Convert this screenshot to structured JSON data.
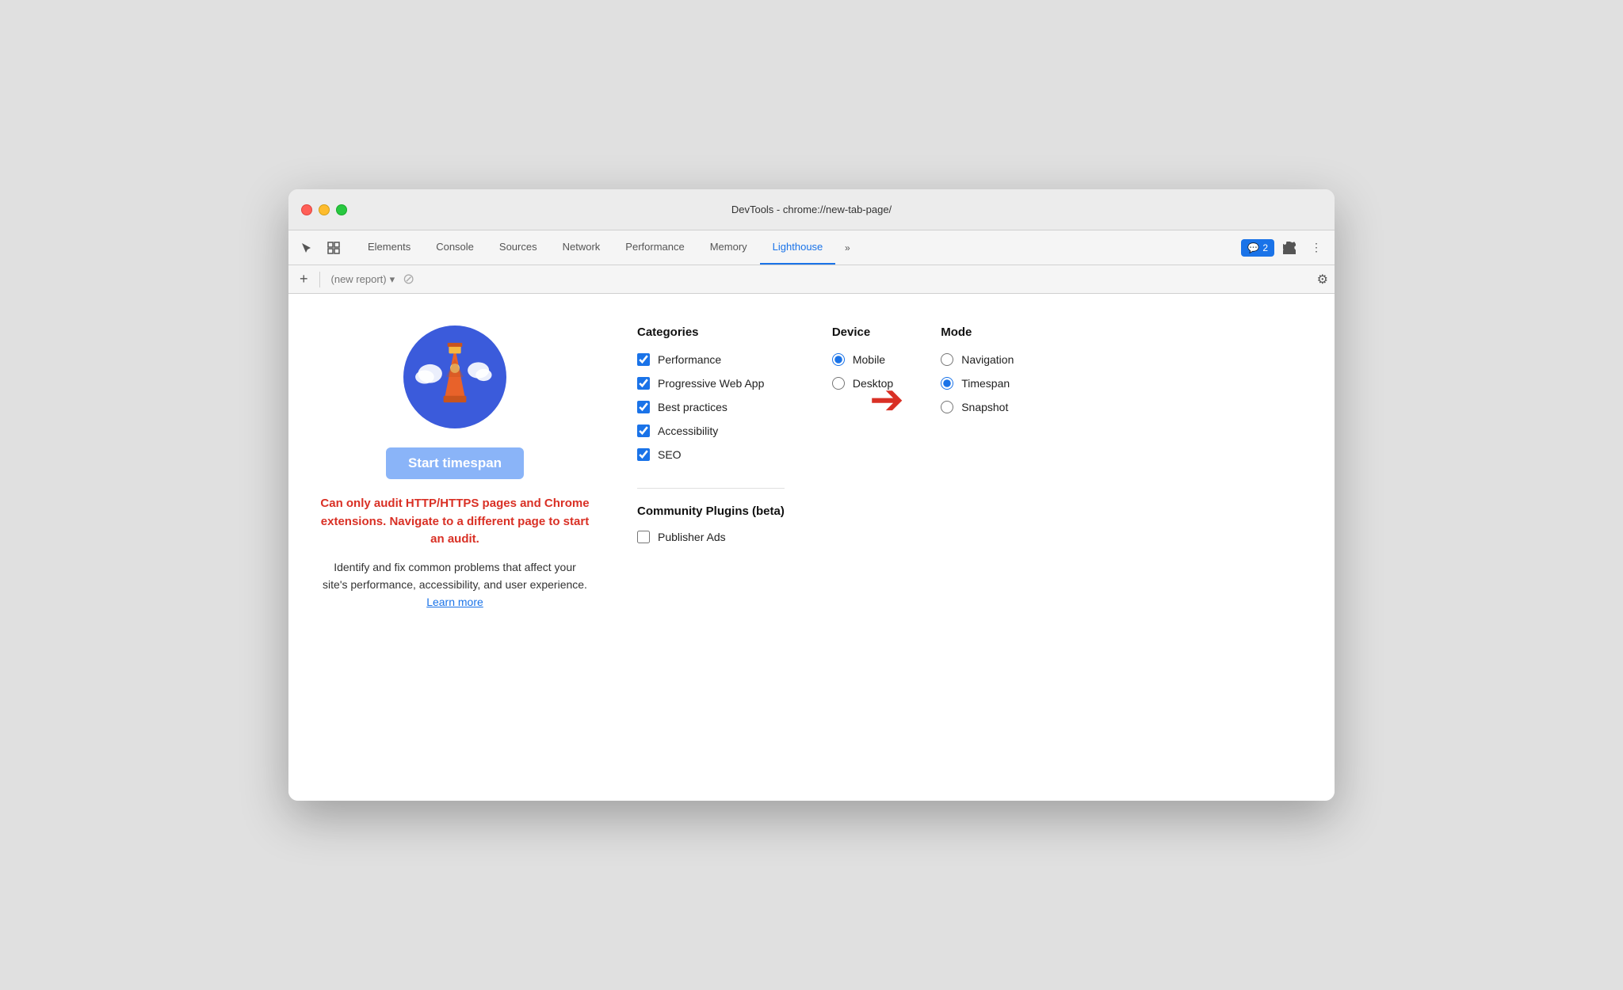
{
  "window": {
    "title": "DevTools - chrome://new-tab-page/"
  },
  "titlebar": {
    "title": "DevTools - chrome://new-tab-page/"
  },
  "tabs": [
    {
      "label": "Elements",
      "active": false
    },
    {
      "label": "Console",
      "active": false
    },
    {
      "label": "Sources",
      "active": false
    },
    {
      "label": "Network",
      "active": false
    },
    {
      "label": "Performance",
      "active": false
    },
    {
      "label": "Memory",
      "active": false
    },
    {
      "label": "Lighthouse",
      "active": true
    }
  ],
  "toolbar": {
    "add_label": "+",
    "report_placeholder": "(new report)",
    "settings_label": "⚙"
  },
  "badge": {
    "icon": "💬",
    "count": "2"
  },
  "left_panel": {
    "start_button": "Start timespan",
    "error_text": "Can only audit HTTP/HTTPS pages and Chrome extensions. Navigate to a different page to start an audit.",
    "desc_text": "Identify and fix common problems that affect your site's performance, accessibility, and user experience.",
    "learn_more": "Learn more"
  },
  "categories": {
    "title": "Categories",
    "items": [
      {
        "label": "Performance",
        "checked": true
      },
      {
        "label": "Progressive Web App",
        "checked": true
      },
      {
        "label": "Best practices",
        "checked": true
      },
      {
        "label": "Accessibility",
        "checked": true
      },
      {
        "label": "SEO",
        "checked": true
      }
    ]
  },
  "community": {
    "title": "Community Plugins (beta)",
    "items": [
      {
        "label": "Publisher Ads",
        "checked": false
      }
    ]
  },
  "device": {
    "title": "Device",
    "items": [
      {
        "label": "Mobile",
        "selected": true
      },
      {
        "label": "Desktop",
        "selected": false
      }
    ]
  },
  "mode": {
    "title": "Mode",
    "items": [
      {
        "label": "Navigation",
        "selected": false
      },
      {
        "label": "Timespan",
        "selected": true
      },
      {
        "label": "Snapshot",
        "selected": false
      }
    ]
  },
  "icons": {
    "cursor": "⬚",
    "inspect": "⬛",
    "more": "»",
    "chevron_down": "▾",
    "no": "⊘",
    "settings": "⚙",
    "three_dots": "⋮"
  }
}
